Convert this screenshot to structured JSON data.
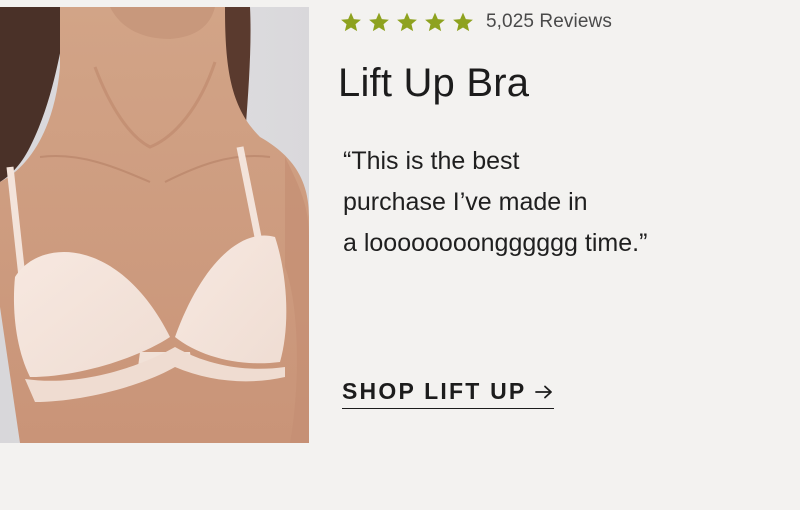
{
  "product": {
    "title": "Lift Up Bra",
    "rating": {
      "stars": 5,
      "max_stars": 5,
      "star_color": "#8ea21f",
      "review_count_label": "5,025 Reviews"
    },
    "quote_lines": [
      "“This is the best",
      "purchase I’ve made in",
      "a loooooooongggggg time.”"
    ],
    "cta": {
      "label": "SHOP LIFT UP",
      "icon": "arrow-right-icon"
    }
  },
  "colors": {
    "background": "#f3f2f0",
    "text": "#1c1c1c",
    "accent_star": "#8ea21f"
  }
}
